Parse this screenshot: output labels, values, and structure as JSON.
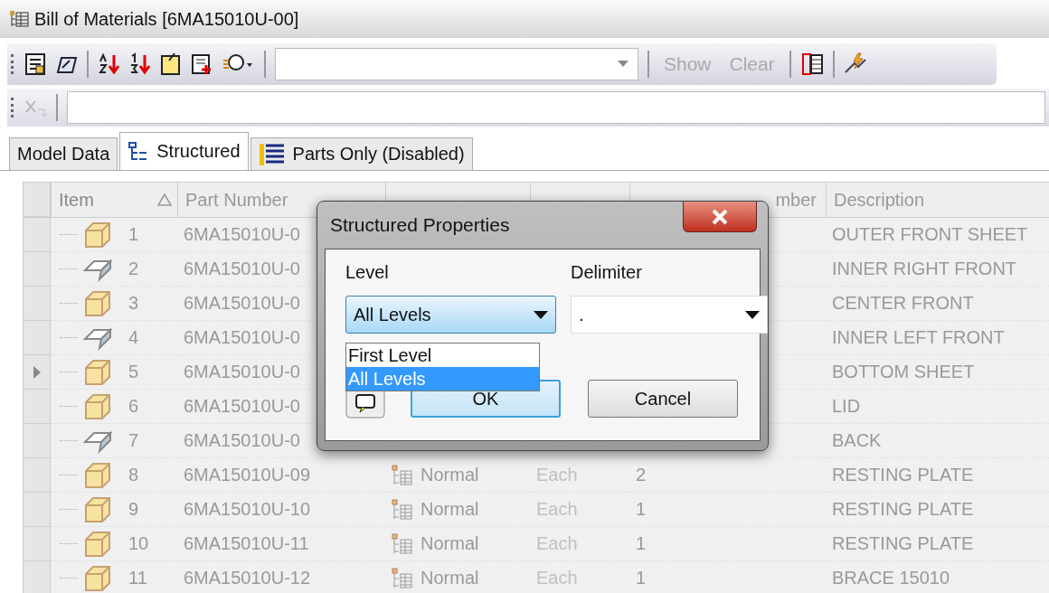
{
  "window": {
    "title": "Bill of Materials [6MA15010U-00]"
  },
  "toolbar": {
    "buttons": [
      {
        "label": "Show",
        "disabled": true
      },
      {
        "label": "Clear",
        "disabled": true
      }
    ]
  },
  "tabs": [
    {
      "label": "Model Data",
      "selected": false,
      "kind": "plain"
    },
    {
      "label": "Structured",
      "selected": true,
      "kind": "tree"
    },
    {
      "label": "Parts Only (Disabled)",
      "selected": false,
      "kind": "list"
    }
  ],
  "table": {
    "columns": [
      {
        "label": "Item",
        "sorted": true
      },
      {
        "label": "Part Number",
        "sorted": false
      },
      {
        "sorted": false
      },
      {
        "sorted": false
      },
      {
        "sorted": false
      },
      {
        "label": "mber",
        "sorted": false
      },
      {
        "label": "Description",
        "sorted": false
      }
    ],
    "rows": [
      {
        "current": false,
        "kind": "part",
        "item": "1",
        "part_number": "6MA15010U-0",
        "description": "OUTER FRONT SHEET"
      },
      {
        "current": false,
        "kind": "sheet",
        "item": "2",
        "part_number": "6MA15010U-0",
        "description": "INNER RIGHT FRONT"
      },
      {
        "current": false,
        "kind": "part",
        "item": "3",
        "part_number": "6MA15010U-0",
        "description": "CENTER FRONT"
      },
      {
        "current": false,
        "kind": "sheet",
        "item": "4",
        "part_number": "6MA15010U-0",
        "description": "INNER LEFT FRONT"
      },
      {
        "current": true,
        "kind": "part",
        "item": "5",
        "part_number": "6MA15010U-0",
        "description": "BOTTOM SHEET"
      },
      {
        "current": false,
        "kind": "part",
        "item": "6",
        "part_number": "6MA15010U-0",
        "description": "LID"
      },
      {
        "current": false,
        "kind": "sheet",
        "item": "7",
        "part_number": "6MA15010U-0",
        "description": "BACK"
      },
      {
        "current": false,
        "kind": "part",
        "item": "8",
        "part_number": "6MA15010U-09",
        "bom_structure": "Normal",
        "unit_qty": "Each",
        "qty": "2",
        "description": "RESTING PLATE"
      },
      {
        "current": false,
        "kind": "part",
        "item": "9",
        "part_number": "6MA15010U-10",
        "bom_structure": "Normal",
        "unit_qty": "Each",
        "qty": "1",
        "description": "RESTING PLATE"
      },
      {
        "current": false,
        "kind": "part",
        "item": "10",
        "part_number": "6MA15010U-11",
        "bom_structure": "Normal",
        "unit_qty": "Each",
        "qty": "1",
        "description": "RESTING PLATE"
      },
      {
        "current": false,
        "kind": "part",
        "item": "11",
        "part_number": "6MA15010U-12",
        "bom_structure": "Normal",
        "unit_qty": "Each",
        "qty": "1",
        "description": "BRACE 15010"
      }
    ]
  },
  "dialog": {
    "title": "Structured Properties",
    "level": {
      "label": "Level",
      "value": "All Levels",
      "options": [
        {
          "label": "First Level",
          "selected": false
        },
        {
          "label": "All Levels",
          "selected": true
        }
      ]
    },
    "delimiter": {
      "label": "Delimiter",
      "value": "."
    },
    "buttons": [
      {
        "label": "OK",
        "kind": "default"
      },
      {
        "label": "Cancel",
        "kind": "normal"
      }
    ]
  }
}
